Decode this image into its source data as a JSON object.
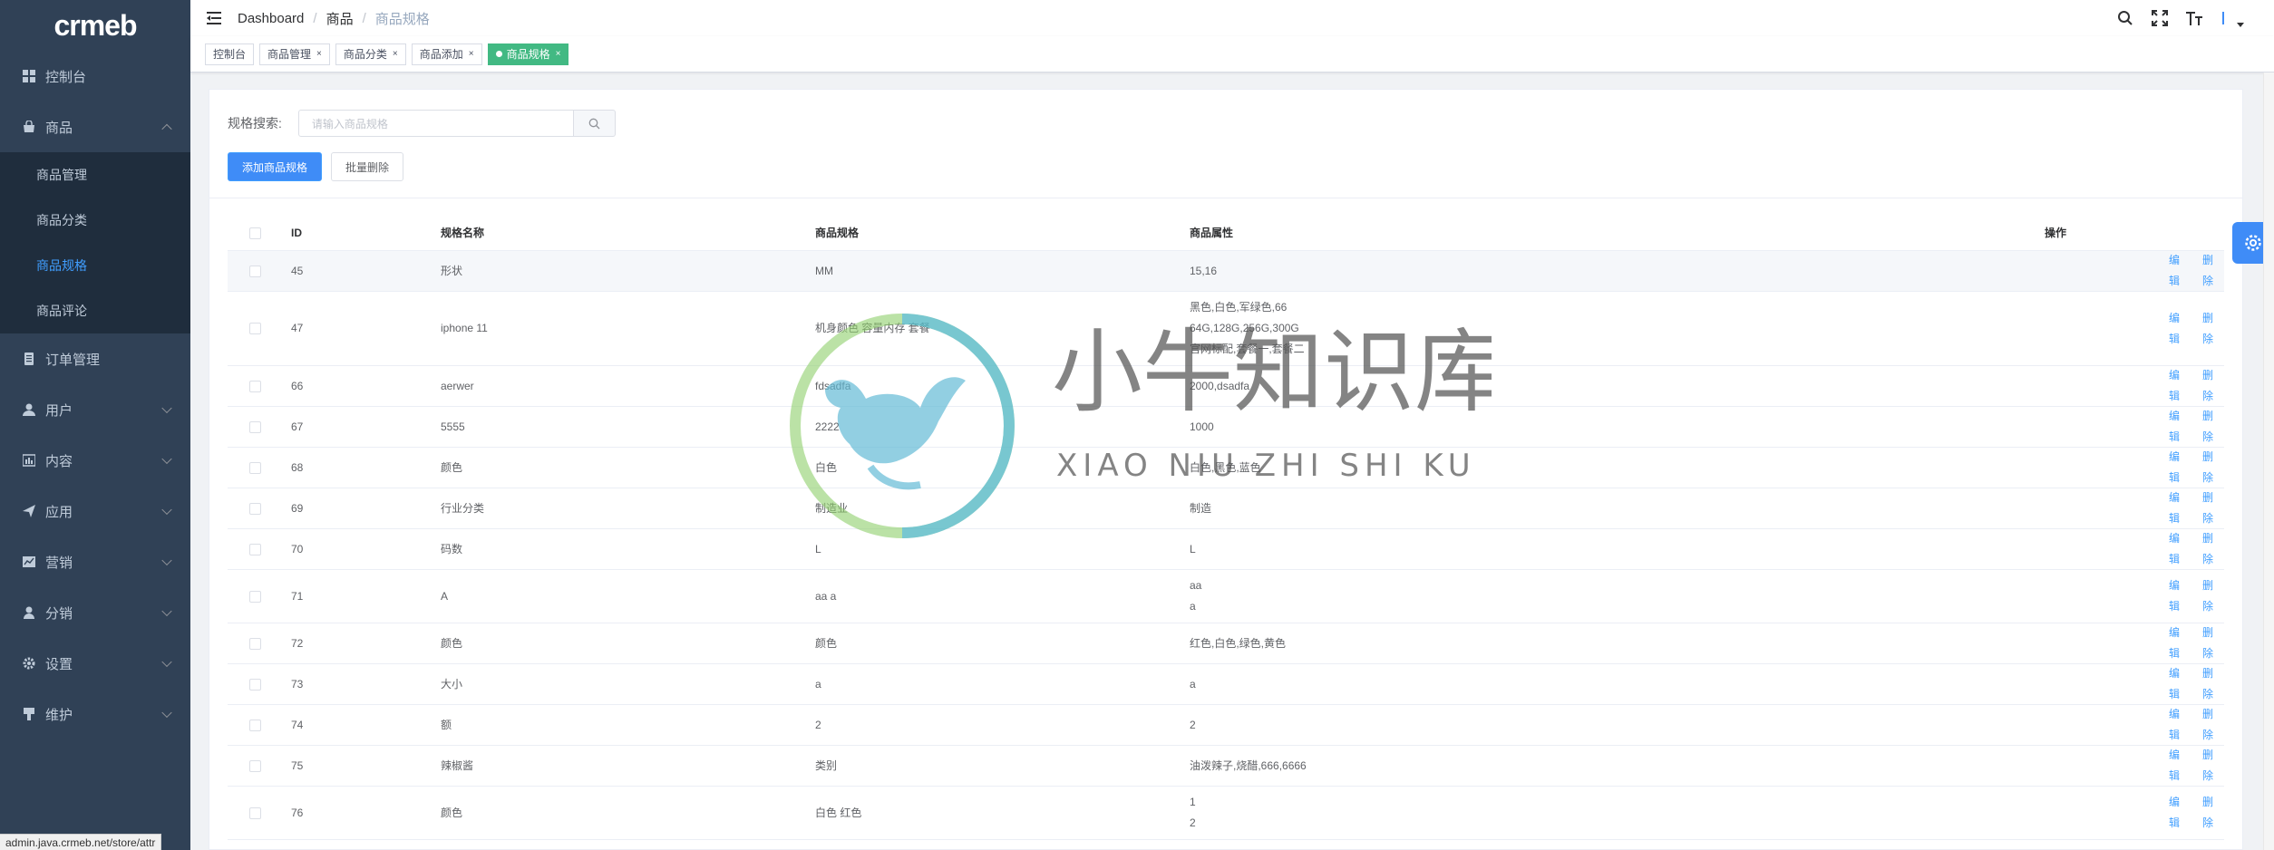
{
  "app": {
    "logo": "crmeb"
  },
  "sidebar": {
    "items": [
      {
        "label": "控制台",
        "icon": "dashboard-icon"
      },
      {
        "label": "商品",
        "icon": "shop-icon",
        "expanded": true,
        "children": [
          "商品管理",
          "商品分类",
          "商品规格",
          "商品评论"
        ],
        "active_child": "商品规格"
      },
      {
        "label": "订单管理",
        "icon": "order-icon"
      },
      {
        "label": "用户",
        "icon": "user-icon"
      },
      {
        "label": "内容",
        "icon": "content-icon"
      },
      {
        "label": "应用",
        "icon": "app-icon"
      },
      {
        "label": "营销",
        "icon": "marketing-icon"
      },
      {
        "label": "分销",
        "icon": "distribution-icon"
      },
      {
        "label": "设置",
        "icon": "settings-icon"
      },
      {
        "label": "维护",
        "icon": "maintain-icon"
      }
    ]
  },
  "breadcrumb": [
    "Dashboard",
    "商品",
    "商品规格"
  ],
  "tags": [
    {
      "label": "控制台",
      "closable": false
    },
    {
      "label": "商品管理",
      "closable": true
    },
    {
      "label": "商品分类",
      "closable": true
    },
    {
      "label": "商品添加",
      "closable": true
    },
    {
      "label": "商品规格",
      "closable": true,
      "active": true
    }
  ],
  "filter": {
    "label": "规格搜索:",
    "placeholder": "请输入商品规格"
  },
  "buttons": {
    "add": "添加商品规格",
    "batch_delete": "批量删除"
  },
  "table": {
    "columns": [
      "ID",
      "规格名称",
      "商品规格",
      "商品属性",
      "操作"
    ],
    "edit_label": "编辑",
    "delete_label": "删除",
    "rows": [
      {
        "id": "45",
        "name": "形状",
        "spec": "MM",
        "attr": [
          "15,16"
        ]
      },
      {
        "id": "47",
        "name": "iphone 11",
        "spec": "机身颜色   容量内存   套餐",
        "attr": [
          "黑色,白色,军绿色,66",
          "64G,128G,256G,300G",
          "官网标配,套餐一,套餐二"
        ]
      },
      {
        "id": "66",
        "name": "aerwer",
        "spec": "fdsadfa",
        "attr": [
          "2000,dsadfa"
        ]
      },
      {
        "id": "67",
        "name": "5555",
        "spec": "2222",
        "attr": [
          "1000"
        ]
      },
      {
        "id": "68",
        "name": "颜色",
        "spec": "白色",
        "attr": [
          "白色,黑色,蓝色"
        ]
      },
      {
        "id": "69",
        "name": "行业分类",
        "spec": "制造业",
        "attr": [
          "制造"
        ]
      },
      {
        "id": "70",
        "name": "码数",
        "spec": "L",
        "attr": [
          "L"
        ]
      },
      {
        "id": "71",
        "name": "A",
        "spec": "aa   a",
        "attr": [
          "aa",
          "a"
        ]
      },
      {
        "id": "72",
        "name": "颜色",
        "spec": "颜色",
        "attr": [
          "红色,白色,绿色,黄色"
        ]
      },
      {
        "id": "73",
        "name": "大小",
        "spec": "a",
        "attr": [
          "a"
        ]
      },
      {
        "id": "74",
        "name": "额",
        "spec": "2",
        "attr": [
          "2"
        ]
      },
      {
        "id": "75",
        "name": "辣椒酱",
        "spec": "类别",
        "attr": [
          "油泼辣子,烧醋,666,6666"
        ]
      },
      {
        "id": "76",
        "name": "颜色",
        "spec": "白色   红色",
        "attr": [
          "1",
          "2"
        ]
      }
    ]
  },
  "watermark": {
    "title": "小牛知识库",
    "subtitle": "XIAO NIU ZHI SHI KU"
  },
  "statusbar": {
    "url": "admin.java.crmeb.net/store/attr"
  },
  "colors": {
    "sidebar_bg": "#304156",
    "primary": "#409eff",
    "active_tag": "#42b983"
  }
}
